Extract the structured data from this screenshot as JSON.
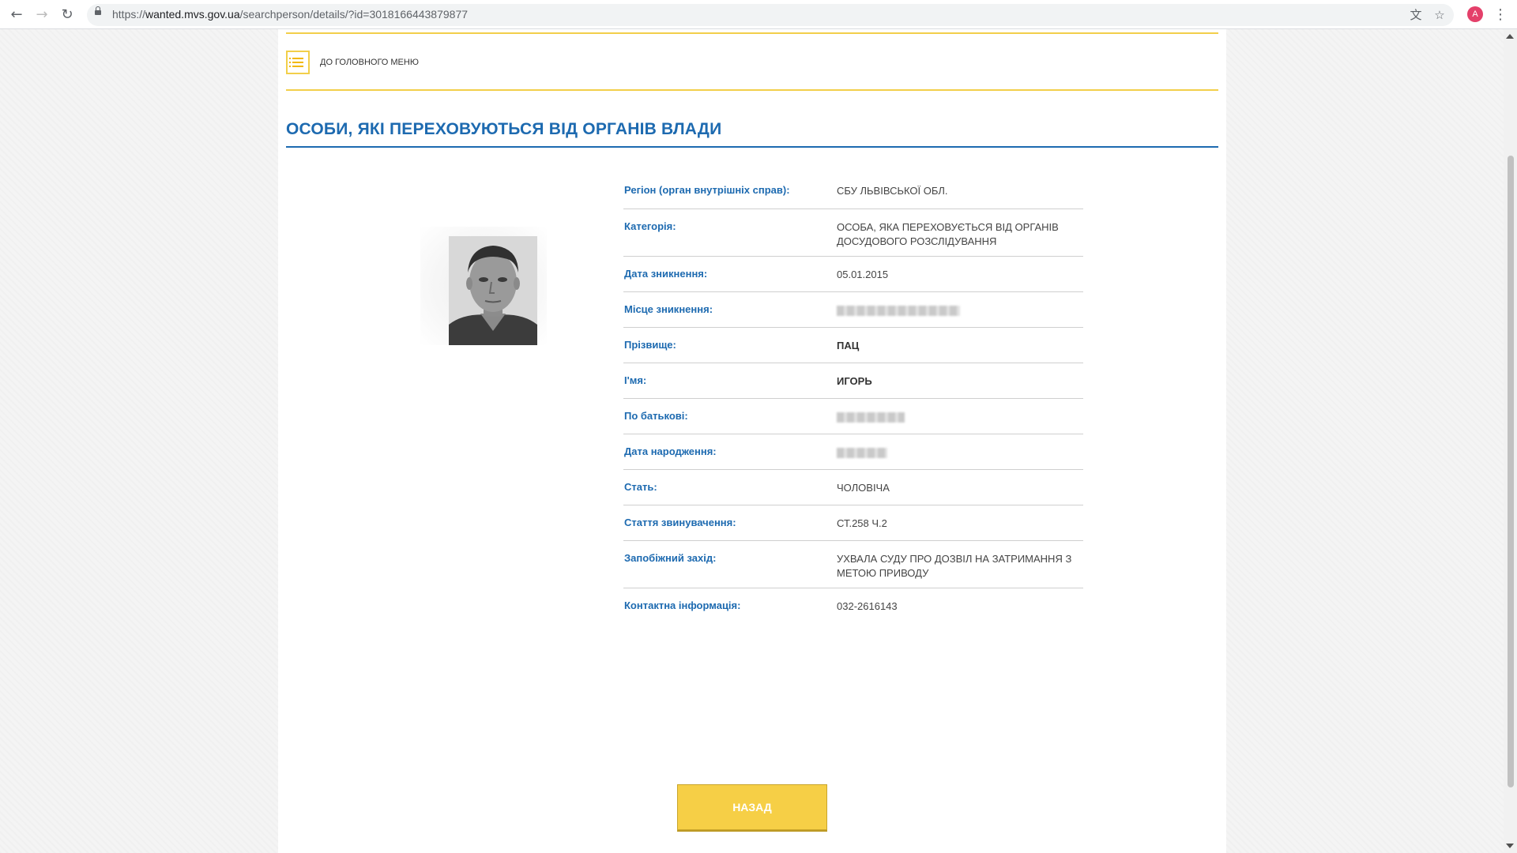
{
  "browser": {
    "url_prefix": "https://",
    "url_host": "wanted.mvs.gov.ua",
    "url_path": "/searchperson/details/?id=3018166443879877",
    "avatar_letter": "A",
    "icons": [
      "back-arrow",
      "forward-arrow",
      "reload",
      "lock",
      "translate",
      "star",
      "menu-dots"
    ]
  },
  "nav": {
    "menu_link": "ДО ГОЛОВНОГО МЕНЮ"
  },
  "page": {
    "title": "ОСОБИ, ЯКІ ПЕРЕХОВУЮТЬСЯ ВІД ОРГАНІВ ВЛАДИ"
  },
  "details": [
    {
      "label": "Регіон (орган внутрішніх справ):",
      "value": "СБУ ЛЬВІВСЬКОЇ ОБЛ."
    },
    {
      "label": "Категорія:",
      "value": "ОСОБА, ЯКА ПЕРЕХОВУЄТЬСЯ ВІД ОРГАНІВ ДОСУДОВОГО РОЗСЛІДУВАННЯ"
    },
    {
      "label": "Дата зникнення:",
      "value": "05.01.2015"
    },
    {
      "label": "Місце зникнення:",
      "value": ""
    },
    {
      "label": "Прізвище:",
      "value": "ПАЦ"
    },
    {
      "label": "І'мя:",
      "value": "ИГОРЬ"
    },
    {
      "label": "По батькові:",
      "value": ""
    },
    {
      "label": "Дата народження:",
      "value": ""
    },
    {
      "label": "Стать:",
      "value": "ЧОЛОВІЧА"
    },
    {
      "label": "Стаття звинувачення:",
      "value": "СТ.258 Ч.2"
    },
    {
      "label": "Запобіжний захід:",
      "value": "УХВАЛА СУДУ ПРО ДОЗВІЛ НА ЗАТРИМАННЯ З МЕТОЮ ПРИВОДУ"
    },
    {
      "label": "Контактна інформація:",
      "value": "032-2616143"
    }
  ],
  "actions": {
    "back_label": "НАЗАД"
  },
  "colors": {
    "accent_blue": "#1d6ab0",
    "accent_yellow": "#f2cf4a",
    "button_yellow": "#f6cf46"
  }
}
